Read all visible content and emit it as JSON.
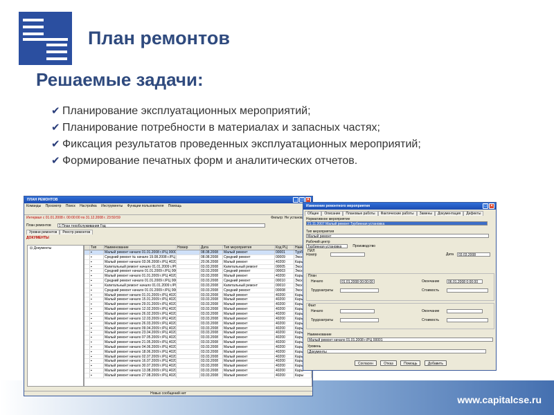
{
  "slide": {
    "title": "План ремонтов",
    "subtitle": "Решаемые задачи:",
    "bullets": [
      "Планирование эксплуатационных мероприятий;",
      "Планирование потребности в материалах и запасных частях;",
      "Фиксация результатов проведенных эксплуатационных мероприятий;",
      "Формирование печатных форм и аналитических отчетов."
    ],
    "url": "www.capitalcse.ru"
  },
  "colors": {
    "brand": "#2f4a7e",
    "window_title": "#2f6fd8"
  },
  "list_window": {
    "title": "ПЛАН РЕМОНТОВ",
    "menu": [
      "Команды",
      "Просмотр",
      "Поиск",
      "Настройка",
      "Инструменты",
      "Функции пользователя",
      "Помощь"
    ],
    "interval_text": "Интервал с 01.01.2008 г. 00:00:00 по 31.12.2008 г. 23:59:59",
    "filter_text": "Фильтр: Не установлен",
    "plan_label": "План ремонтов",
    "plan_value": "1 План техобслуживания Год",
    "tabs": [
      "Уровни ремонтов",
      "Реестр ремонтов"
    ],
    "tree_title": "ДОКУМЕНТЫ",
    "tree_item": "Документы",
    "columns": [
      "Тип",
      "Статус",
      "Наименование",
      "Номер",
      "Дата",
      "Тип мероприятия",
      "Код РЦ",
      "Наим"
    ],
    "rows": [
      [
        "Малый ремонт начало 01.01.2008 г./РЦ 00001",
        "08.08.2008",
        "Малый ремонт",
        "00001",
        "Турб"
      ],
      [
        "Средний ремонт № начало 19.08.2008 г./РЦ 0000",
        "08.08.2008",
        "Средний ремонт",
        "00009",
        "Экск"
      ],
      [
        "Малый ремонт начало 03.06.2008 г./РЦ 40200",
        "20.06.2008",
        "Малый ремонт",
        "40200",
        "Кары"
      ],
      [
        "Капитальный ремонт начало 01.01.2009 г./РЦ 00005",
        "03.03.2008",
        "Капитальный ремонт",
        "00005",
        "Экск"
      ],
      [
        "Средний ремонт начало 01.01.2009 г./РЦ 00003",
        "03.03.2008",
        "Средний ремонт",
        "00003",
        "Экск"
      ],
      [
        "Малый ремонт начало 01.01.2009 г./РЦ 40200",
        "03.03.2008",
        "Малый ремонт",
        "40200",
        "Кары"
      ],
      [
        "Средний ремонт начало 01.01.2009 г./РЦ 00010",
        "03.03.2008",
        "Средний ремонт",
        "00010",
        "Экск"
      ],
      [
        "Капитальный ремонт начало 01.01.2009 г./РЦ 0",
        "03.03.2008",
        "Капитальный ремонт",
        "00010",
        "Экск"
      ],
      [
        "Средний ремонт начало 01.01.2009 г./РЦ 00008",
        "03.03.2008",
        "Средний ремонт",
        "00008",
        "Экск"
      ],
      [
        "Малый ремонт начало 01.01.2009 г./РЦ 40200",
        "03.03.2008",
        "Малый ремонт",
        "40200",
        "Кары"
      ],
      [
        "Малый ремонт начало 15.01.2009 г./РЦ 40200",
        "03.03.2008",
        "Малый ремонт",
        "40200",
        "Кары"
      ],
      [
        "Малый ремонт начало 29.01.2009 г./РЦ 40200",
        "03.03.2008",
        "Малый ремонт",
        "40200",
        "Кары"
      ],
      [
        "Малый ремонт начало 12.02.2009 г./РЦ 40200",
        "03.03.2008",
        "Малый ремонт",
        "40200",
        "Кары"
      ],
      [
        "Малый ремонт начало 26.02.2009 г./РЦ 40200",
        "03.03.2008",
        "Малый ремонт",
        "40200",
        "Кары"
      ],
      [
        "Малый ремонт начало 12.03.2009 г./РЦ 40200",
        "03.03.2008",
        "Малый ремонт",
        "40200",
        "Кары"
      ],
      [
        "Малый ремонт начало 26.03.2009 г./РЦ 40200",
        "03.03.2008",
        "Малый ремонт",
        "40200",
        "Кары"
      ],
      [
        "Малый ремонт начало 09.04.2009 г./РЦ 40200",
        "03.03.2008",
        "Малый ремонт",
        "40200",
        "Кары"
      ],
      [
        "Малый ремонт начало 23.04.2009 г./РЦ 40200",
        "03.03.2008",
        "Малый ремонт",
        "40200",
        "Кары"
      ],
      [
        "Малый ремонт начало 07.05.2009 г./РЦ 40200",
        "03.03.2008",
        "Малый ремонт",
        "40200",
        "Кары"
      ],
      [
        "Малый ремонт начало 21.05.2009 г./РЦ 40200",
        "03.03.2008",
        "Малый ремонт",
        "40200",
        "Кары"
      ],
      [
        "Малый ремонт начало 04.06.2009 г./РЦ 40200",
        "03.03.2008",
        "Малый ремонт",
        "40200",
        "Кары"
      ],
      [
        "Малый ремонт начало 18.06.2009 г./РЦ 40200",
        "03.03.2008",
        "Малый ремонт",
        "40200",
        "Кары"
      ],
      [
        "Малый ремонт начало 02.07.2009 г./РЦ 40200",
        "03.03.2008",
        "Малый ремонт",
        "40200",
        "Кары"
      ],
      [
        "Малый ремонт начало 16.07.2009 г./РЦ 40200",
        "03.03.2008",
        "Малый ремонт",
        "40200",
        "Кары"
      ],
      [
        "Малый ремонт начало 30.07.2009 г./РЦ 40200",
        "03.03.2008",
        "Малый ремонт",
        "40200",
        "Кары"
      ],
      [
        "Малый ремонт начало 13.08.2009 г./РЦ 40200",
        "03.03.2008",
        "Малый ремонт",
        "40200",
        "Кары"
      ],
      [
        "Малый ремонт начало 27.08.2009 г./РЦ 40200",
        "03.03.2008",
        "Малый ремонт",
        "40200",
        "Кары"
      ]
    ],
    "status": "Новых сообщений нет"
  },
  "form_window": {
    "title": "Изменение ремонтного мероприятия",
    "tabs": [
      "Общее",
      "Описание",
      "Плановые работы",
      "Фактические работы",
      "Замены",
      "Документация",
      "Дефекты"
    ],
    "norm_label": "Нормативное мероприятие",
    "norm_value": "21.11.2007 Малый ремонт Турбинная установка",
    "type_label": "Тип мероприятия",
    "type_value": "Малый ремонт",
    "center_label": "Рабочий центр",
    "center_value": "Турбинная установка ПИЛ",
    "center_extra": "Производство",
    "number_label": "Номер",
    "date_label": "Дата",
    "date_value": "03.03.2008",
    "plan_group": "План",
    "fact_group": "Факт",
    "start_label": "Начало",
    "end_label": "Окончание",
    "labor_label": "Трудозатраты",
    "cost_label": "Стоимость",
    "plan_start": "01.01.2008 00:00:00",
    "plan_end": "06.01.2008 0:00:00",
    "name_label": "Наименование",
    "name_value": "Малый ремонт начало 01.01.2008 г./РЦ 00001",
    "level_label": "Уровень",
    "level_value": "Документы",
    "buttons": [
      "Согласен",
      "Отказ",
      "Помощь",
      "Добавить"
    ]
  }
}
